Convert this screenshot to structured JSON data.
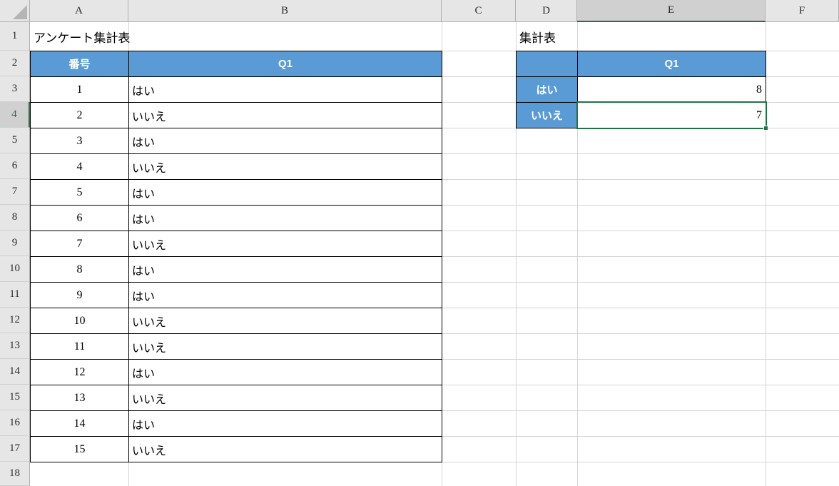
{
  "spreadsheet": {
    "column_headers": [
      "A",
      "B",
      "C",
      "D",
      "E",
      "F"
    ],
    "row_headers": [
      "1",
      "2",
      "3",
      "4",
      "5",
      "6",
      "7",
      "8",
      "9",
      "10",
      "11",
      "12",
      "13",
      "14",
      "15",
      "16",
      "17",
      "18"
    ],
    "selected_cell": "E4",
    "selected_column": "E",
    "selected_row": "4",
    "accent_color": "#5B9BD5",
    "selection_color": "#217346",
    "header_bg": "#E6E6E6",
    "header_bg_selected": "#D0D0D0",
    "gridline_color": "#D4D4D4"
  },
  "survey_table": {
    "title": "アンケート集計表",
    "headers": {
      "no": "番号",
      "q1": "Q1"
    },
    "rows": [
      {
        "no": "1",
        "q1": "はい"
      },
      {
        "no": "2",
        "q1": "いいえ"
      },
      {
        "no": "3",
        "q1": "はい"
      },
      {
        "no": "4",
        "q1": "いいえ"
      },
      {
        "no": "5",
        "q1": "はい"
      },
      {
        "no": "6",
        "q1": "はい"
      },
      {
        "no": "7",
        "q1": "いいえ"
      },
      {
        "no": "8",
        "q1": "はい"
      },
      {
        "no": "9",
        "q1": "はい"
      },
      {
        "no": "10",
        "q1": "いいえ"
      },
      {
        "no": "11",
        "q1": "いいえ"
      },
      {
        "no": "12",
        "q1": "はい"
      },
      {
        "no": "13",
        "q1": "いいえ"
      },
      {
        "no": "14",
        "q1": "はい"
      },
      {
        "no": "15",
        "q1": "いいえ"
      }
    ]
  },
  "summary_table": {
    "title": "集計表",
    "corner": "",
    "column_header": "Q1",
    "rows": [
      {
        "label": "はい",
        "count": "8"
      },
      {
        "label": "いいえ",
        "count": "7"
      }
    ]
  }
}
